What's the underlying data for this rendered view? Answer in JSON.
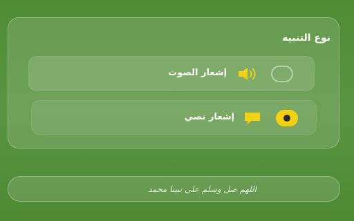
{
  "settings": {
    "title": "نوع التنبيه",
    "options": [
      {
        "label": "إشعار الصوت",
        "icon": "speaker-icon",
        "selected": false
      },
      {
        "label": "إشعار نصي",
        "icon": "message-icon",
        "selected": true
      }
    ]
  },
  "footer": {
    "text": "اللهم صل وسلم على نبينا محمد"
  },
  "colors": {
    "background": "#558f3a",
    "accent": "#f5d20f"
  }
}
